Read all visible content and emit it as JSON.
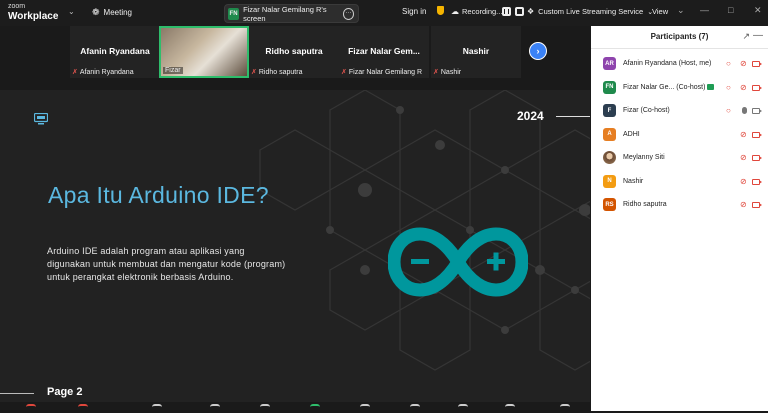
{
  "app": {
    "brand_line1": "zoom",
    "brand_line2": "Workplace"
  },
  "header": {
    "meeting_label": "Meeting",
    "share_avatar": "FN",
    "share_label": "Fizar Nalar Gemilang R's screen",
    "sign_in": "Sign in",
    "recording_label": "Recording...",
    "live_label": "Custom Live Streaming Service",
    "view_label": "View"
  },
  "video_strip": {
    "tiles": [
      {
        "name": "Afanin Ryandana",
        "label": "Afanin Ryandana",
        "muted": true
      },
      {
        "name": "",
        "label": "Fizar",
        "muted": false,
        "active": true
      },
      {
        "name": "Ridho saputra",
        "label": "Ridho saputra",
        "muted": true
      },
      {
        "name": "Fizar Nalar Gem...",
        "label": "Fizar Nalar Gemilang R",
        "muted": true
      },
      {
        "name": "Nashir",
        "label": "Nashir",
        "muted": true
      }
    ],
    "next_icon": "chevron-right-icon"
  },
  "slide": {
    "year": "2024",
    "title": "Apa Itu Arduino IDE?",
    "description": "Arduino IDE adalah program atau aplikasi yang digunakan untuk membuat dan mengatur kode (program) untuk perangkat elektronik berbasis Arduino.",
    "page": "Page 2",
    "logo_color": "#00979d",
    "title_color": "#5bb8e0"
  },
  "participants": {
    "title": "Participants (7)",
    "list": [
      {
        "initials": "AR",
        "name": "Afanin Ryandana (Host, me)",
        "color": "#8e44ad",
        "mic": "muted",
        "video": "off",
        "hand": true
      },
      {
        "initials": "FN",
        "name": "Fizar Nalar Ge... (Co-host)",
        "color": "#1f8a4c",
        "mic": "muted",
        "video": "off",
        "hand": true,
        "sharing": true
      },
      {
        "initials": "F",
        "name": "Fizar (Co-host)",
        "color": "#2c3e50",
        "mic": "on",
        "video": "on",
        "hand": true
      },
      {
        "initials": "A",
        "name": "ADHI",
        "color": "#e67e22",
        "mic": "muted",
        "video": "off",
        "hand": false
      },
      {
        "initials": "",
        "name": "Meylanny Siti",
        "color": "#9a7b5a",
        "mic": "muted",
        "video": "off",
        "hand": false
      },
      {
        "initials": "N",
        "name": "Nashir",
        "color": "#f39c12",
        "mic": "muted",
        "video": "off",
        "hand": false
      },
      {
        "initials": "RS",
        "name": "Ridho saputra",
        "color": "#d35400",
        "mic": "muted",
        "video": "off",
        "hand": false
      }
    ]
  }
}
